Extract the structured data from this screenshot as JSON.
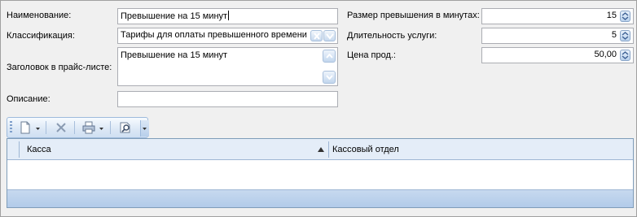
{
  "form": {
    "name_label": "Наименование:",
    "name_value": "Превышение на 15 минут",
    "classification_label": "Классификация:",
    "classification_value": "Тарифы для оплаты превышенного времени",
    "pricelist_title_label": "Заголовок в прайс-листе:",
    "pricelist_title_value": "Превышение на 15 минут",
    "description_label": "Описание:",
    "description_value": "",
    "overrun_minutes_label": "Размер превышения в минутах:",
    "overrun_minutes_value": "15",
    "duration_label": "Длительность услуги:",
    "duration_value": "5",
    "price_label": "Цена прод.:",
    "price_value": "50,00"
  },
  "toolbar": {
    "icons": [
      "new-icon",
      "delete-icon",
      "print-icon",
      "search-icon"
    ]
  },
  "grid": {
    "columns": [
      "Касса",
      "Кассовый отдел"
    ],
    "sort_column": "Касса",
    "rows": []
  },
  "colors": {
    "header_bg": "#e4edf8",
    "footer_bg": "#b8cfeb",
    "accent": "#4a7fc1"
  }
}
